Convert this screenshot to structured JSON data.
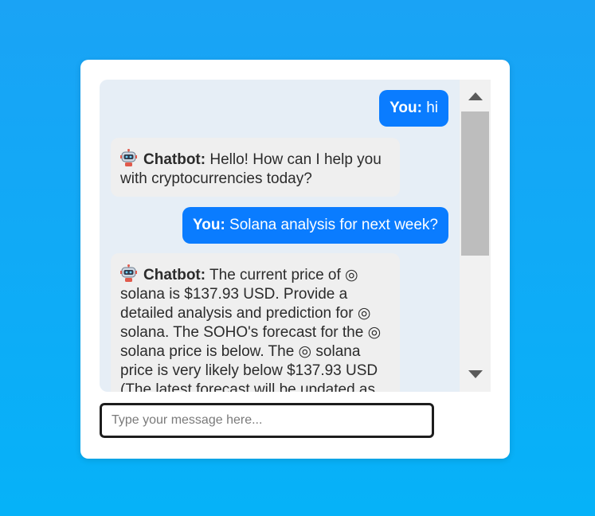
{
  "messages": [
    {
      "sender": "You:",
      "text": " hi",
      "role": "user"
    },
    {
      "sender": "Chatbot:",
      "text": " Hello! How can I help you with cryptocurrencies today?",
      "role": "bot"
    },
    {
      "sender": "You:",
      "text": " Solana analysis for next week?",
      "role": "user"
    },
    {
      "sender": "Chatbot:",
      "text": " The current price of ◎ solana is $137.93 USD. Provide a detailed analysis and prediction for ◎ solana. The SOHO's forecast for the ◎ solana price is below. The ◎ solana price is very likely below $137.93 USD (The latest forecast will be updated as",
      "role": "bot"
    }
  ],
  "input": {
    "placeholder": "Type your message here..."
  },
  "icons": {
    "bot_avatar": "robot-icon",
    "scroll_up": "scroll-up-arrow-icon",
    "scroll_down": "scroll-down-arrow-icon"
  },
  "colors": {
    "user_bubble": "#0a7cff",
    "bot_bubble": "#efefef",
    "background": "#1aa3f5"
  }
}
